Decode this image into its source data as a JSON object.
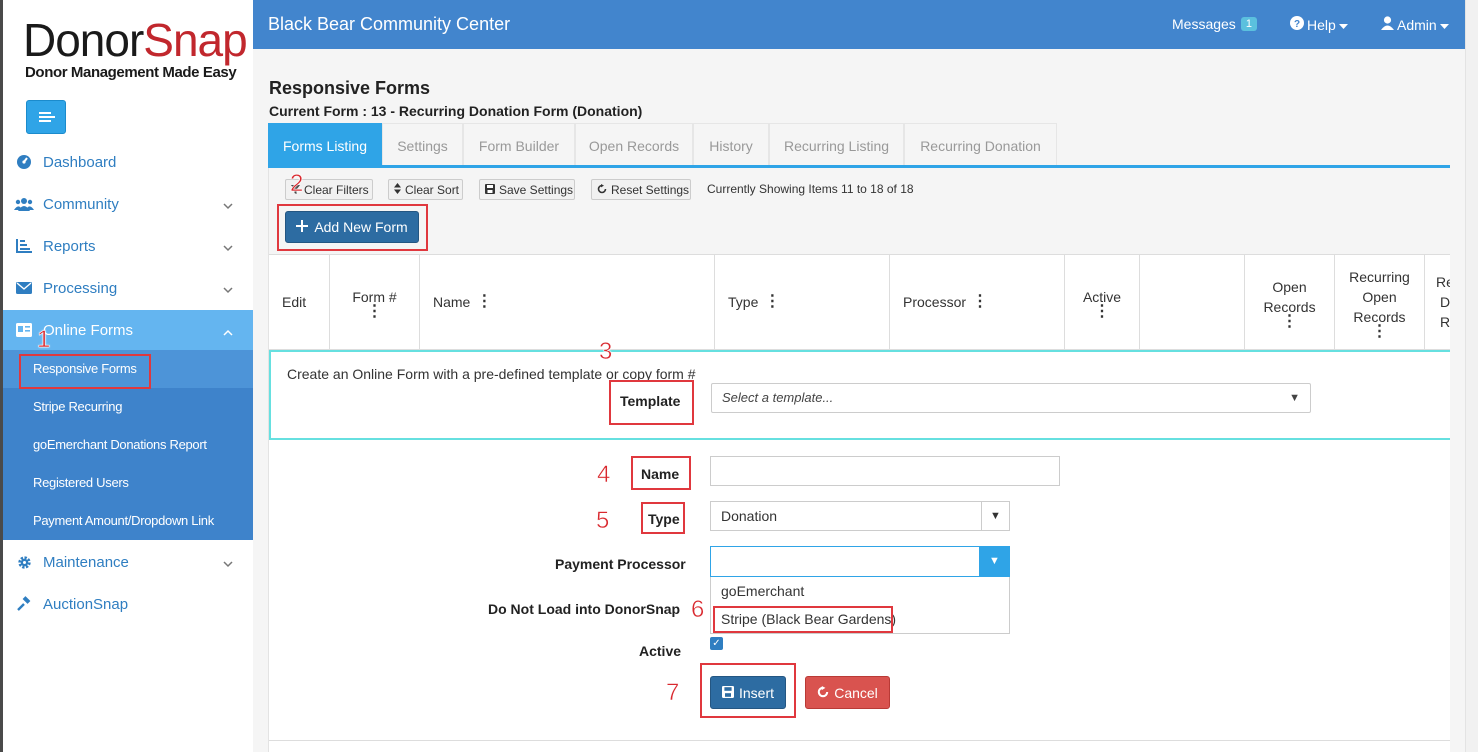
{
  "logo": {
    "word_a": "Donor",
    "word_b": "Snap",
    "tagline": "Donor Management Made Easy"
  },
  "header": {
    "title": "Black Bear Community Center",
    "messages_label": "Messages",
    "messages_count": "1",
    "help_label": "Help",
    "admin_label": "Admin"
  },
  "sidebar": {
    "items": [
      {
        "label": "Dashboard",
        "icon": "dashboard-icon"
      },
      {
        "label": "Community",
        "icon": "users-icon"
      },
      {
        "label": "Reports",
        "icon": "chart-icon"
      },
      {
        "label": "Processing",
        "icon": "envelope-icon"
      },
      {
        "label": "Online Forms",
        "icon": "form-icon"
      },
      {
        "label": "Maintenance",
        "icon": "gear-icon"
      },
      {
        "label": "AuctionSnap",
        "icon": "gavel-icon"
      }
    ],
    "sub_items": [
      "Responsive Forms",
      "Stripe Recurring",
      "goEmerchant Donations Report",
      "Registered Users",
      "Payment Amount/Dropdown Link"
    ]
  },
  "page": {
    "title": "Responsive Forms",
    "current_form": "Current Form : 13 - Recurring Donation Form (Donation)"
  },
  "tabs": [
    "Forms Listing",
    "Settings",
    "Form Builder",
    "Open Records",
    "History",
    "Recurring Listing",
    "Recurring Donation"
  ],
  "toolbar": {
    "clear_filters": "Clear Filters",
    "clear_sort": "Clear Sort",
    "save_settings": "Save Settings",
    "reset_settings": "Reset Settings",
    "showing": "Currently Showing Items 11 to 18 of 18",
    "add_new_form": "Add New Form"
  },
  "table": {
    "columns": [
      "Edit",
      "Form #",
      "Name",
      "Type",
      "Processor",
      "Active",
      "",
      "Open Records",
      "Recurring Open Records",
      "Re D R"
    ]
  },
  "form": {
    "intro": "Create an Online Form with a pre-defined template or copy form #",
    "template_label": "Template",
    "template_placeholder": "Select a template...",
    "name_label": "Name",
    "name_value": "",
    "type_label": "Type",
    "type_value": "Donation",
    "processor_label": "Payment Processor",
    "processor_options": [
      "goEmerchant",
      "Stripe (Black Bear Gardens)"
    ],
    "dnl_label": "Do Not Load into DonorSnap",
    "active_label": "Active",
    "active_checked": true,
    "insert_label": "Insert",
    "cancel_label": "Cancel"
  },
  "annotations": [
    "1",
    "2",
    "3",
    "4",
    "5",
    "6",
    "7"
  ],
  "colors": {
    "header": "#4285cd",
    "accent": "#2fa4e7",
    "primary_btn": "#2d6ca2",
    "danger_btn": "#d9534f",
    "highlight": "#e0383e"
  }
}
